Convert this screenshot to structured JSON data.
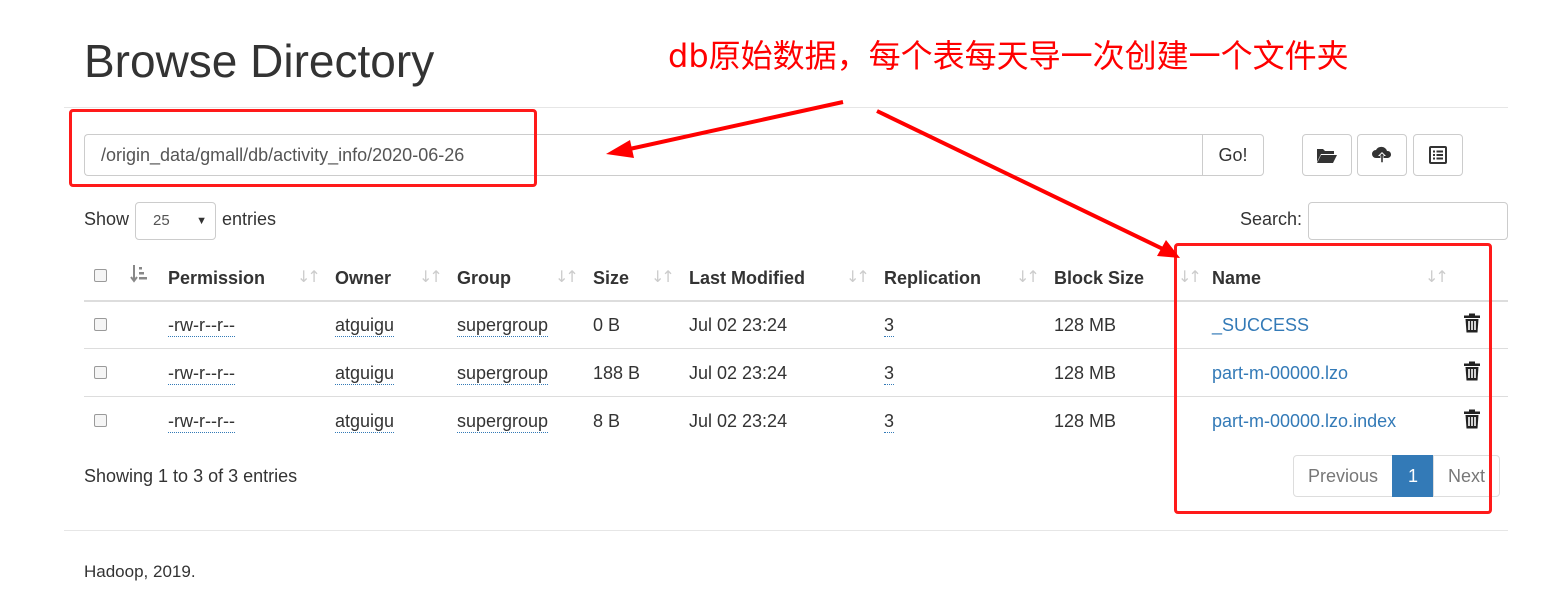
{
  "header": {
    "title": "Browse Directory",
    "annotation": "db原始数据，每个表每天导一次创建一个文件夹"
  },
  "path_bar": {
    "path_value": "/origin_data/gmall/db/activity_info/2020-06-26",
    "go_label": "Go!",
    "tools": [
      "folder-open-icon",
      "cloud-upload-icon",
      "list-alt-icon"
    ]
  },
  "length_control": {
    "show_label": "Show",
    "selected": "25",
    "entries_label": "entries"
  },
  "search": {
    "label": "Search:",
    "value": ""
  },
  "table": {
    "columns": [
      "Permission",
      "Owner",
      "Group",
      "Size",
      "Last Modified",
      "Replication",
      "Block Size",
      "Name"
    ],
    "rows": [
      {
        "permission": "-rw-r--r--",
        "owner": "atguigu",
        "group": "supergroup",
        "size": "0 B",
        "modified": "Jul 02 23:24",
        "replication": "3",
        "block_size": "128 MB",
        "name": "_SUCCESS"
      },
      {
        "permission": "-rw-r--r--",
        "owner": "atguigu",
        "group": "supergroup",
        "size": "188 B",
        "modified": "Jul 02 23:24",
        "replication": "3",
        "block_size": "128 MB",
        "name": "part-m-00000.lzo"
      },
      {
        "permission": "-rw-r--r--",
        "owner": "atguigu",
        "group": "supergroup",
        "size": "8 B",
        "modified": "Jul 02 23:24",
        "replication": "3",
        "block_size": "128 MB",
        "name": "part-m-00000.lzo.index"
      }
    ]
  },
  "info": "Showing 1 to 3 of 3 entries",
  "pagination": {
    "previous": "Previous",
    "current": "1",
    "next": "Next"
  },
  "footer": "Hadoop, 2019.",
  "colors": {
    "link": "#337ab7",
    "annotation_red": "#ff0000",
    "active_page": "#337ab7"
  }
}
